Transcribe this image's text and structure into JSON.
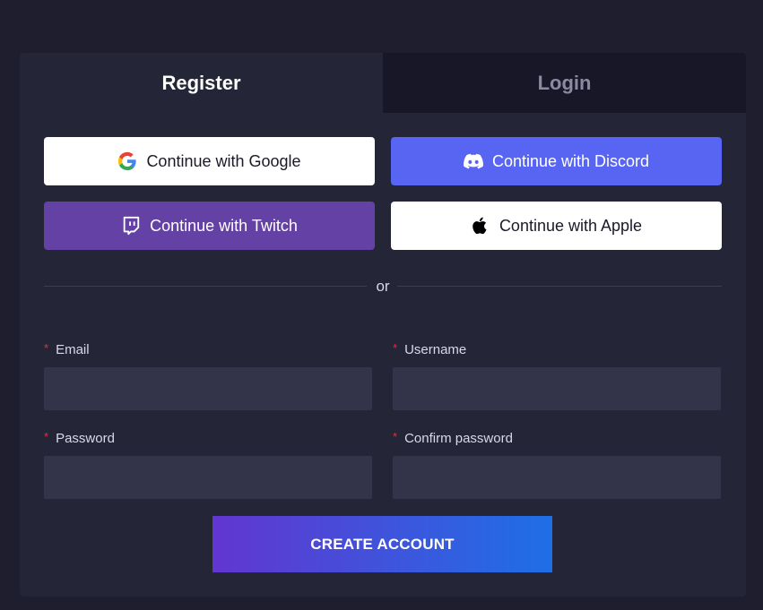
{
  "tabs": {
    "register": "Register",
    "login": "Login"
  },
  "social": {
    "google": {
      "label": "Continue with Google",
      "icon": "google-icon"
    },
    "discord": {
      "label": "Continue with Discord",
      "icon": "discord-icon",
      "color": "#5865f2"
    },
    "twitch": {
      "label": "Continue with Twitch",
      "icon": "twitch-icon",
      "color": "#6441a5"
    },
    "apple": {
      "label": "Continue with Apple",
      "icon": "apple-icon"
    }
  },
  "divider_text": "or",
  "form": {
    "required_marker": "*",
    "email": {
      "label": "Email",
      "value": ""
    },
    "username": {
      "label": "Username",
      "value": ""
    },
    "password": {
      "label": "Password",
      "value": ""
    },
    "confirm_password": {
      "label": "Confirm password",
      "value": ""
    }
  },
  "submit_label": "CREATE ACCOUNT",
  "colors": {
    "background": "#1e1e2e",
    "panel": "#252538",
    "input": "#33334a",
    "required": "#e0323f",
    "gradient_start": "#6236d0",
    "gradient_end": "#1e6fe6"
  }
}
